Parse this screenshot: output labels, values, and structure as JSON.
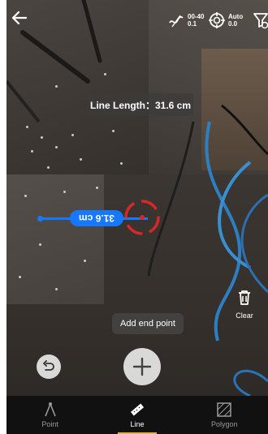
{
  "topbar": {
    "back_label": "",
    "precision": {
      "range": "00-40",
      "value": "0.1"
    },
    "mode": {
      "label": "Auto",
      "value": "0.0"
    }
  },
  "measurement": {
    "length_label": "Line Length：31.6 cm",
    "dimension_label": "31.6 cm"
  },
  "actions": {
    "clear_label": "Clear",
    "hint": "Add end point"
  },
  "nav": {
    "items": [
      {
        "label": "Point",
        "icon": "point-tool-icon",
        "active": false
      },
      {
        "label": "Line",
        "icon": "line-ruler-icon",
        "active": true
      },
      {
        "label": "Polygon",
        "icon": "polygon-tool-icon",
        "active": false
      }
    ]
  },
  "colors": {
    "accent": "#1678ff",
    "reticle": "#d62828",
    "active_tab_indicator": "#f5b400"
  }
}
